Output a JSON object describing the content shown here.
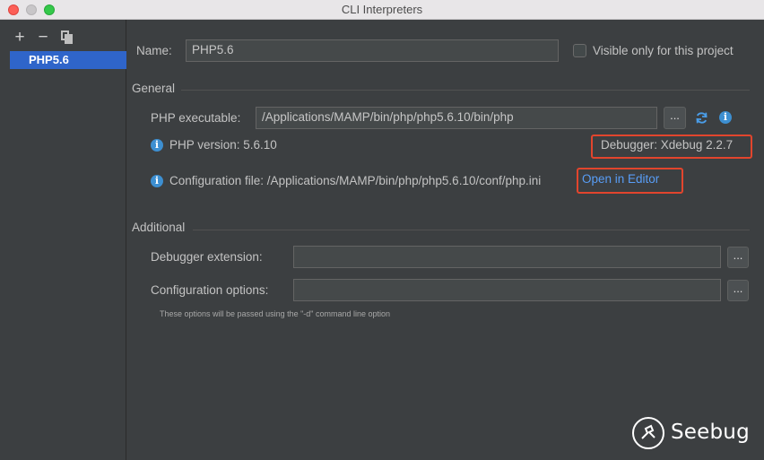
{
  "window": {
    "title": "CLI Interpreters"
  },
  "sidebar": {
    "toolbar": {
      "add_label": "+",
      "remove_label": "−"
    },
    "items": [
      {
        "label": "PHP5.6",
        "selected": true
      }
    ]
  },
  "form": {
    "name_label": "Name:",
    "name_value": "PHP5.6",
    "visible_label": "Visible only for this project",
    "visible_checked": false
  },
  "general": {
    "title": "General",
    "php_exec_label": "PHP executable:",
    "php_exec_value": "/Applications/MAMP/bin/php/php5.6.10/bin/php",
    "browse_label": "...",
    "php_version": "PHP version: 5.6.10",
    "debugger": "Debugger: Xdebug 2.2.7",
    "config_file": "Configuration file: /Applications/MAMP/bin/php/php5.6.10/conf/php.ini",
    "open_in_editor": "Open in Editor"
  },
  "additional": {
    "title": "Additional",
    "debugger_ext_label": "Debugger extension:",
    "debugger_ext_value": "",
    "config_options_label": "Configuration options:",
    "config_options_value": "",
    "browse_label": "...",
    "hint": "These options will be passed using the \"-d\" command line option"
  },
  "watermark": {
    "text": "Seebug"
  },
  "colors": {
    "background": "#3c3f41",
    "selection": "#2f65ca",
    "link": "#589df6",
    "highlight_box": "#e2452d",
    "info_icon": "#3d8fd1"
  }
}
